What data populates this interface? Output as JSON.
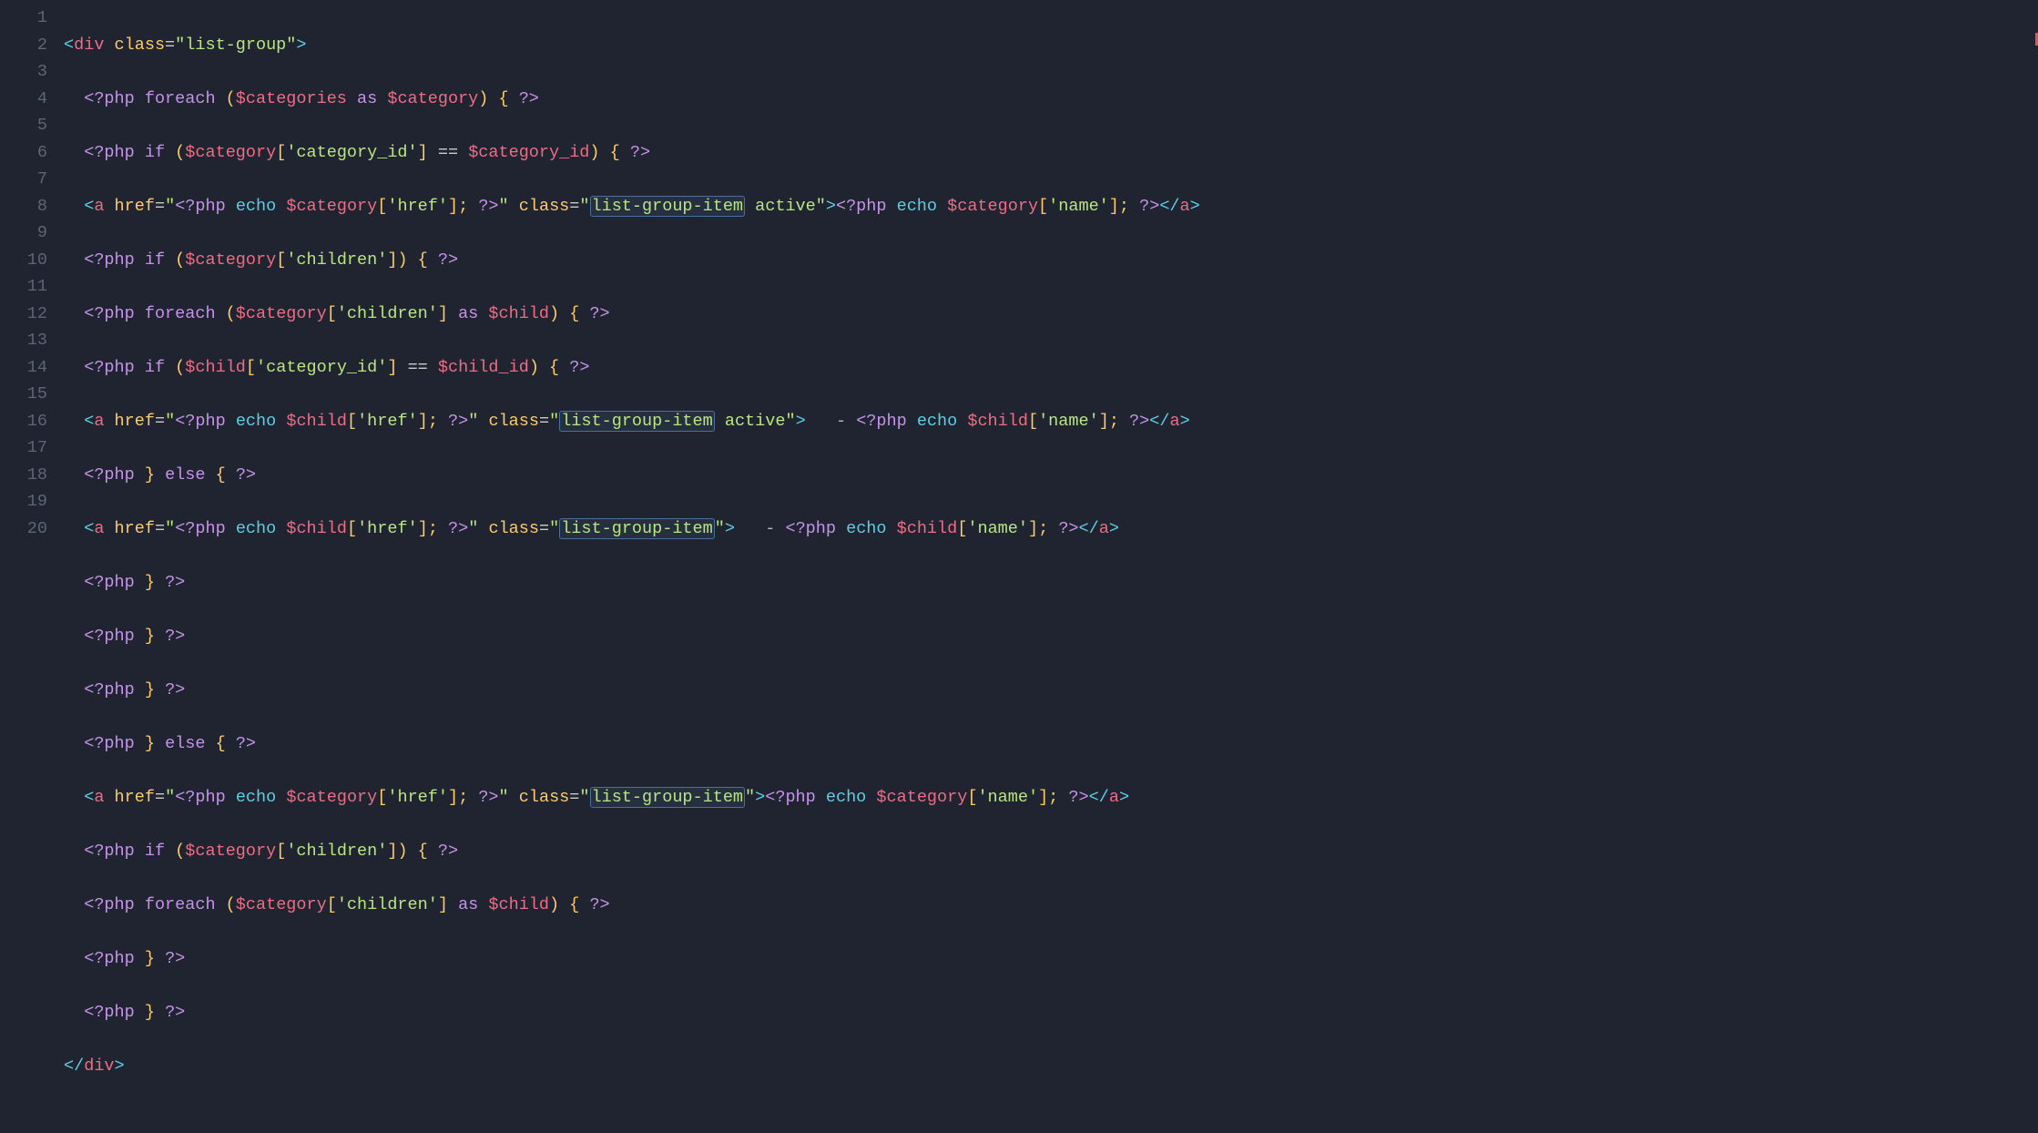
{
  "lines": {
    "l1": {
      "n": "1"
    },
    "l2": {
      "n": "2"
    },
    "l3": {
      "n": "3"
    },
    "l4": {
      "n": "4"
    },
    "l5": {
      "n": "5"
    },
    "l6": {
      "n": "6"
    },
    "l7": {
      "n": "7"
    },
    "l8": {
      "n": "8"
    },
    "l9": {
      "n": "9"
    },
    "l10": {
      "n": "10"
    },
    "l11": {
      "n": "11"
    },
    "l12": {
      "n": "12"
    },
    "l13": {
      "n": "13"
    },
    "l14": {
      "n": "14"
    },
    "l15": {
      "n": "15"
    },
    "l16": {
      "n": "16"
    },
    "l17": {
      "n": "17"
    },
    "l18": {
      "n": "18"
    },
    "l19": {
      "n": "19"
    },
    "l20": {
      "n": "20"
    }
  },
  "tok": {
    "lt": "<",
    "gt": ">",
    "lts": "</",
    "div": "div",
    "a": "a",
    "class": "class",
    "href": "href",
    "eq": "=",
    "dq": "\"",
    "listgroup": "list-group",
    "lgi": "list-group-item",
    "active": " active",
    "php_o": "<?php",
    "php_c": "?>",
    "foreach": "foreach",
    "if": "if",
    "else": "else",
    "as": "as",
    "echo": "echo",
    "categories": "$categories",
    "category": "$category",
    "category_id": "$category_id",
    "child": "$child",
    "child_id": "$child_id",
    "k_catid": "'category_id'",
    "k_href": "'href'",
    "k_name": "'name'",
    "k_children": "'children'",
    "lp": "(",
    "rp": ")",
    "lb": "{",
    "rb": "}",
    "lbr": "[",
    "rbr": "]",
    "semi": ";",
    "sp": " ",
    "eqeq": "==",
    "dash": "   - "
  }
}
